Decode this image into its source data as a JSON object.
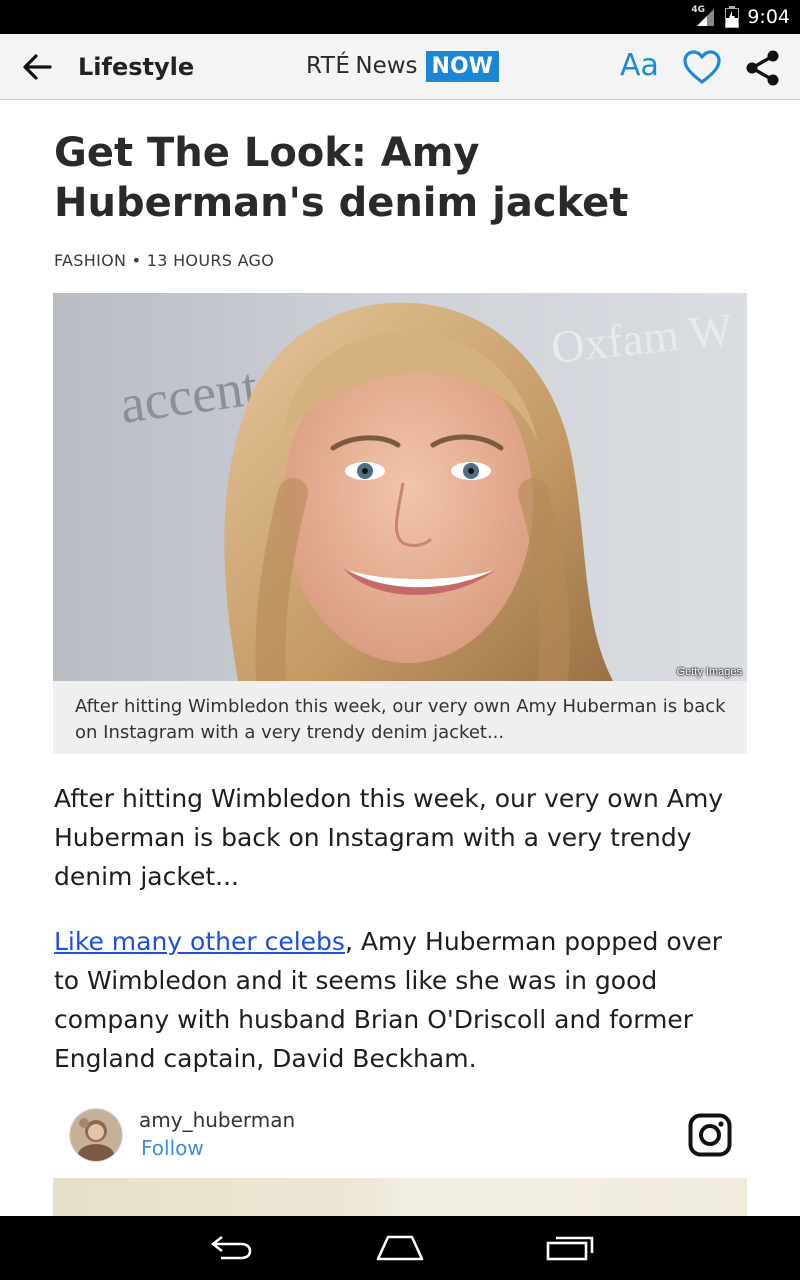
{
  "status_bar": {
    "network_label": "4G",
    "time": "9:04",
    "icons": [
      "signal-icon",
      "battery-icon"
    ]
  },
  "app_bar": {
    "back_icon": "arrow-left-icon",
    "section_title": "Lifestyle",
    "brand": {
      "rte": "RTÉ",
      "news": "News",
      "now": "NOW",
      "now_color": "#1a86d6"
    },
    "font_size_label": "Aa",
    "favorite_icon": "heart-icon",
    "share_icon": "share-icon",
    "accent_color": "#1c8ad8"
  },
  "article": {
    "headline": "Get The Look: Amy Huberman's denim jacket",
    "meta": "FASHION • 13 HOURS AGO",
    "image_credit": "Getty Images",
    "caption": "After hitting Wimbledon this week, our very own Amy Huberman is back on Instagram with a very trendy denim jacket...",
    "paragraph_1": "After hitting Wimbledon this week, our very own Amy Huberman is back on Instagram with a very trendy denim jacket...",
    "paragraph_2": {
      "link_text": "Like many other celebs",
      "text": ", Amy Huberman popped over to Wimbledon and it seems like she was in good company with husband Brian O'Driscoll and former England captain, David Beckham.",
      "link_color": "#1a4fe0"
    }
  },
  "instagram_embed": {
    "username": "amy_huberman",
    "follow_label": "Follow",
    "follow_color": "#3b8fe0",
    "logo_icon": "instagram-icon"
  },
  "nav_bar": {
    "icons": [
      "back-nav-icon",
      "home-nav-icon",
      "recents-nav-icon"
    ]
  }
}
